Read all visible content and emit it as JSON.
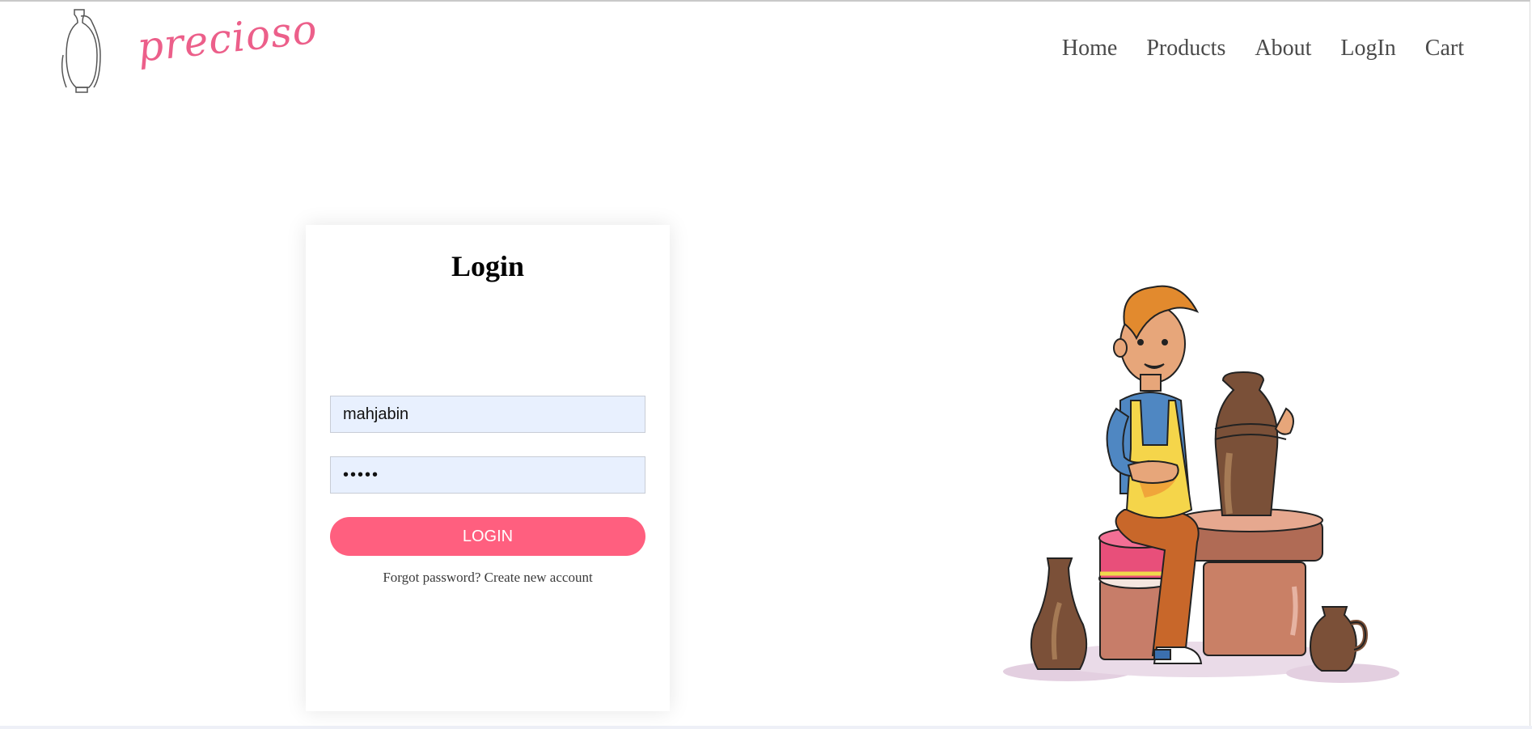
{
  "brand": {
    "name": "precioso"
  },
  "nav": {
    "items": [
      {
        "label": "Home"
      },
      {
        "label": "Products"
      },
      {
        "label": "About"
      },
      {
        "label": "LogIn"
      },
      {
        "label": "Cart"
      }
    ]
  },
  "login": {
    "title": "Login",
    "username_value": "mahjabin",
    "password_value": "•••••",
    "button_label": "LOGIN",
    "forgot_label": "Forgot password?",
    "create_label": "Create new account"
  },
  "colors": {
    "brand_pink": "#ec5f8a",
    "button_pink": "#ff5f7f",
    "input_bg": "#e8f0fe"
  }
}
